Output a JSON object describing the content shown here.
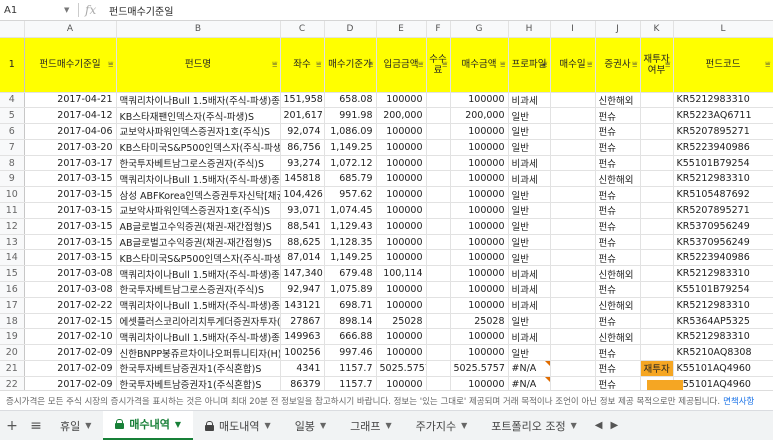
{
  "formula_bar": {
    "cell_ref": "A1",
    "fx_label": "fx",
    "content": "펀드매수기준일"
  },
  "columns": [
    "A",
    "B",
    "C",
    "D",
    "E",
    "F",
    "G",
    "H",
    "I",
    "J",
    "K",
    "L"
  ],
  "header_row_num": "1",
  "headers": [
    "펀드매수기준일",
    "펀드명",
    "좌수",
    "매수기준가",
    "입금금액",
    "수수료",
    "매수금액",
    "프로파일",
    "매수일",
    "증권사",
    "재투자여부",
    "펀드코드"
  ],
  "rows": [
    {
      "n": "4",
      "a": "2017-04-21",
      "b": "맥쿼리차이나Bull 1.5배자(주식-파생)종류",
      "c": "151,958",
      "d": "658.08",
      "e": "100000",
      "g": "100000",
      "h": "비과세",
      "j": "신한해외",
      "l": "KR5212983310"
    },
    {
      "n": "5",
      "a": "2017-04-12",
      "b": "KB스타재팬인덱스자(주식-파생)S",
      "c": "201,617",
      "d": "991.98",
      "e": "200,000",
      "g": "200,000",
      "h": "일반",
      "j": "펀슈",
      "l": "KR5223AQ6711"
    },
    {
      "n": "6",
      "a": "2017-04-06",
      "b": "교보악사파워인덱스증권자1호(주식)S",
      "c": "92,074",
      "d": "1,086.09",
      "e": "100000",
      "g": "100000",
      "h": "일반",
      "j": "펀슈",
      "l": "KR5207895271"
    },
    {
      "n": "7",
      "a": "2017-03-20",
      "b": "KB스타미국S&P500인덱스자(주식-파생)S",
      "c": "86,756",
      "d": "1,149.25",
      "e": "100000",
      "g": "100000",
      "h": "일반",
      "j": "펀슈",
      "l": "KR5223940986"
    },
    {
      "n": "8",
      "a": "2017-03-17",
      "b": "한국투자베트남그로스증권자(주식)S",
      "c": "93,274",
      "d": "1,072.12",
      "e": "100000",
      "g": "100000",
      "h": "비과세",
      "j": "펀슈",
      "l": "K55101B79254"
    },
    {
      "n": "9",
      "a": "2017-03-15",
      "b": "맥쿼리차이나Bull 1.5배자(주식-파생)종류",
      "c": "145818",
      "d": "685.79",
      "e": "100000",
      "g": "100000",
      "h": "비과세",
      "j": "신한해외",
      "l": "KR5212983310"
    },
    {
      "n": "10",
      "a": "2017-03-15",
      "b": "삼성 ABFKorea인덱스증권투자신탁[채권]",
      "c": "104,426",
      "d": "957.62",
      "e": "100000",
      "g": "100000",
      "h": "일반",
      "j": "펀슈",
      "l": "KR5105487692"
    },
    {
      "n": "11",
      "a": "2017-03-15",
      "b": "교보악사파워인덱스증권자1호(주식)S",
      "c": "93,071",
      "d": "1,074.45",
      "e": "100000",
      "g": "100000",
      "h": "일반",
      "j": "펀슈",
      "l": "KR5207895271"
    },
    {
      "n": "12",
      "a": "2017-03-15",
      "b": "AB글로벌고수익증권(채권-재간접형)S",
      "c": "88,541",
      "d": "1,129.43",
      "e": "100000",
      "g": "100000",
      "h": "일반",
      "j": "펀슈",
      "l": "KR5370956249"
    },
    {
      "n": "13",
      "a": "2017-03-15",
      "b": "AB글로벌고수익증권(채권-재간접형)S",
      "c": "88,625",
      "d": "1,128.35",
      "e": "100000",
      "g": "100000",
      "h": "일반",
      "j": "펀슈",
      "l": "KR5370956249"
    },
    {
      "n": "14",
      "a": "2017-03-15",
      "b": "KB스타미국S&P500인덱스자(주식-파생)S",
      "c": "87,014",
      "d": "1,149.25",
      "e": "100000",
      "g": "100000",
      "h": "일반",
      "j": "펀슈",
      "l": "KR5223940986"
    },
    {
      "n": "15",
      "a": "2017-03-08",
      "b": "맥쿼리차이나Bull 1.5배자(주식-파생)종류",
      "c": "147,340",
      "d": "679.48",
      "e": "100,114",
      "g": "100000",
      "h": "비과세",
      "j": "신한해외",
      "l": "KR5212983310"
    },
    {
      "n": "16",
      "a": "2017-03-08",
      "b": "한국투자베트남그로스증권자(주식)S",
      "c": "92,947",
      "d": "1,075.89",
      "e": "100000",
      "g": "100000",
      "h": "비과세",
      "j": "펀슈",
      "l": "K55101B79254"
    },
    {
      "n": "17",
      "a": "2017-02-22",
      "b": "맥쿼리차이나Bull 1.5배자(주식-파생)종류",
      "c": "143121",
      "d": "698.71",
      "e": "100000",
      "g": "100000",
      "h": "비과세",
      "j": "신한해외",
      "l": "KR5212983310"
    },
    {
      "n": "18",
      "a": "2017-02-15",
      "b": "에셋플러스코리아리치투게더증권자투자(",
      "c": "27867",
      "d": "898.14",
      "e": "25028",
      "g": "25028",
      "h": "일반",
      "j": "펀슈",
      "l": "KR5364AP5325"
    },
    {
      "n": "19",
      "a": "2017-02-10",
      "b": "맥쿼리차이나Bull 1.5배자(주식-파생)종류",
      "c": "149963",
      "d": "666.88",
      "e": "100000",
      "g": "100000",
      "h": "비과세",
      "j": "신한해외",
      "l": "KR5212983310"
    },
    {
      "n": "20",
      "a": "2017-02-09",
      "b": "신한BNPP봉쥬르차이나오퍼튜니티자(H)[",
      "c": "100256",
      "d": "997.46",
      "e": "100000",
      "g": "100000",
      "h": "일반",
      "j": "펀슈",
      "l": "KR5210AQ8308"
    },
    {
      "n": "21",
      "a": "2017-02-09",
      "b": "한국투자베트남증권자1(주식혼합)S",
      "c": "4341",
      "d": "1157.7",
      "e": "5025.5757",
      "g": "5025.5757",
      "h": "#N/A",
      "j": "펀슈",
      "k": "재투자",
      "l": "K55101AQ4960"
    },
    {
      "n": "22",
      "a": "2017-02-09",
      "b": "한국투자베트남증권자1(주식혼합)S",
      "c": "86379",
      "d": "1157.7",
      "e": "100000",
      "g": "100000",
      "h": "#N/A",
      "j": "펀슈",
      "l": "K55101AQ4960"
    }
  ],
  "info_bar": {
    "text": "증시가격은 모든 주식 시장의 증시가격을 표시하는 것은 아니며 최대 20분 전 정보일을 참고하시기 바랍니다. 정보는 '있는 그대로' 제공되며 거래 목적이나 조언이 아닌 정보 제공 목적으로만 제공됩니다.",
    "link": "면책사항"
  },
  "tabs": [
    {
      "label": "휴일",
      "locked": false,
      "active": false
    },
    {
      "label": "매수내역",
      "locked": true,
      "active": true
    },
    {
      "label": "매도내역",
      "locked": true,
      "active": false
    },
    {
      "label": "일봉",
      "locked": false,
      "active": false
    },
    {
      "label": "그래프",
      "locked": false,
      "active": false
    },
    {
      "label": "주가지수",
      "locked": false,
      "active": false
    },
    {
      "label": "포트폴리오 조정",
      "locked": false,
      "active": false
    }
  ],
  "colors": {
    "header_fill": "#ffff00",
    "active_tab": "#188038",
    "note_fill": "#f5a623"
  }
}
